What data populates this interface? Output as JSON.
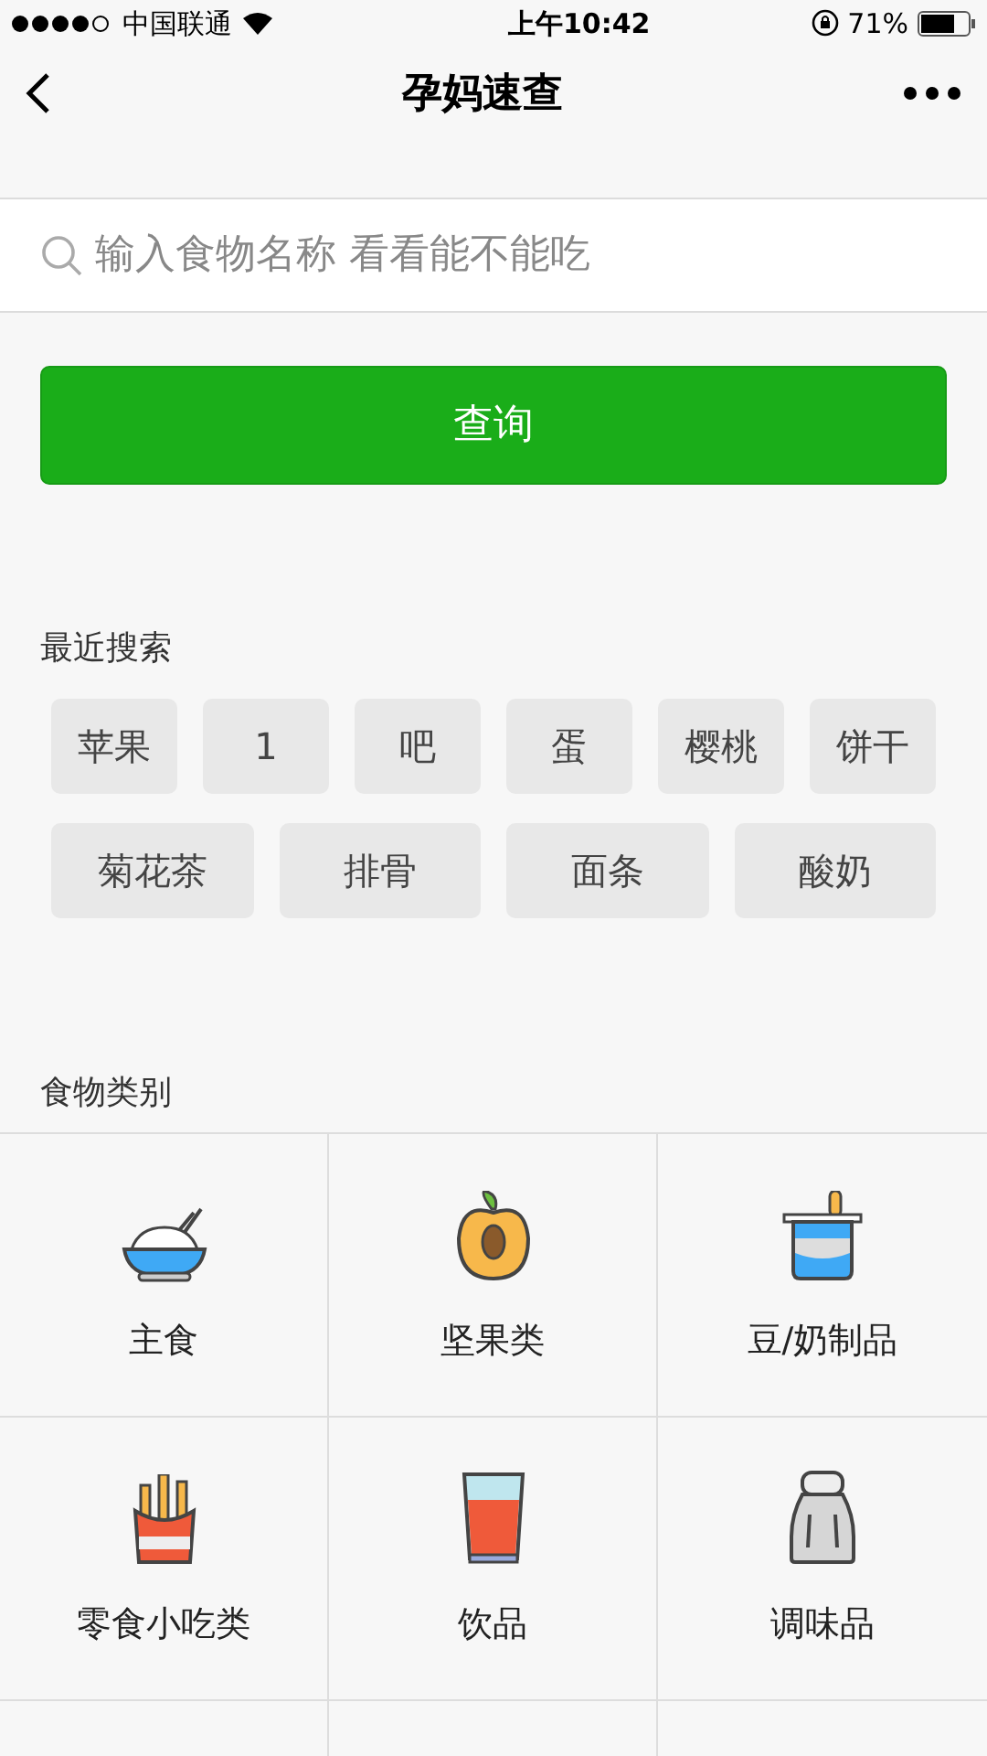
{
  "status_bar": {
    "carrier": "中国联通",
    "time": "上午10:42",
    "battery": "71%"
  },
  "nav": {
    "title": "孕妈速查"
  },
  "search": {
    "placeholder": "输入食物名称 看看能不能吃"
  },
  "query_button": "查询",
  "recent_searches": {
    "title": "最近搜索",
    "tags": [
      "苹果",
      "1",
      "吧",
      "蛋",
      "樱桃",
      "饼干",
      "菊花茶",
      "排骨",
      "面条",
      "酸奶"
    ]
  },
  "categories": {
    "title": "食物类别",
    "items": [
      {
        "label": "主食"
      },
      {
        "label": "坚果类"
      },
      {
        "label": "豆/奶制品"
      },
      {
        "label": "零食小吃类"
      },
      {
        "label": "饮品"
      },
      {
        "label": "调味品"
      }
    ]
  }
}
